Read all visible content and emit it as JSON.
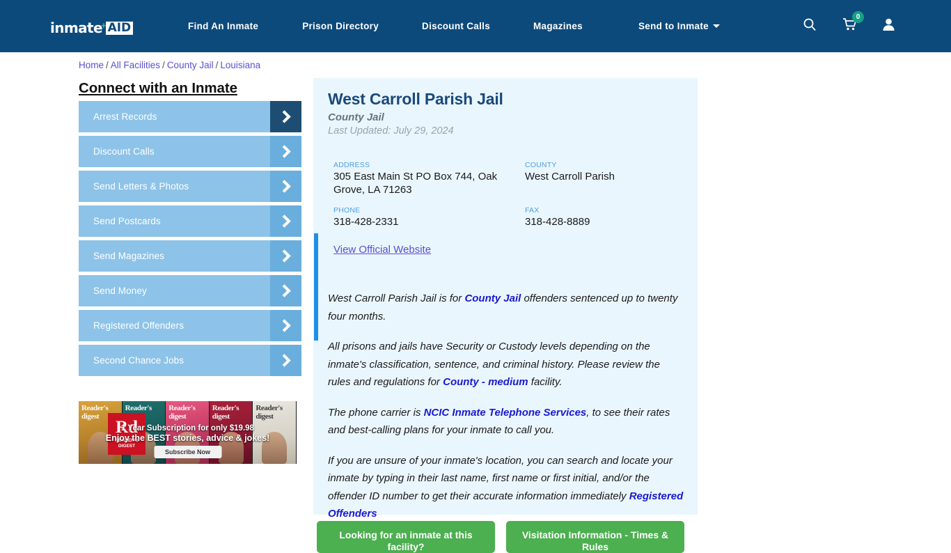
{
  "header": {
    "logo": {
      "text": "inmate",
      "plus": "+",
      "aid": "AID"
    },
    "nav": [
      {
        "label": "Find An Inmate"
      },
      {
        "label": "Prison Directory"
      },
      {
        "label": "Discount Calls"
      },
      {
        "label": "Magazines"
      },
      {
        "label": "Send to Inmate"
      }
    ],
    "icons": {
      "search": "search-icon",
      "cart": "cart-icon",
      "user": "user-icon"
    },
    "cart_count": "0",
    "bg_color": "#0d4a7c",
    "badge_color": "#16a085"
  },
  "breadcrumb": {
    "items": [
      "Home",
      "All Facilities",
      "County Jail",
      "Louisiana"
    ],
    "separator": "/"
  },
  "sidebar": {
    "title": "Connect with an Inmate",
    "items": [
      {
        "label": "Arrest Records",
        "active": true
      },
      {
        "label": "Discount Calls",
        "active": false
      },
      {
        "label": "Send Letters & Photos",
        "active": false
      },
      {
        "label": "Send Postcards",
        "active": false
      },
      {
        "label": "Send Magazines",
        "active": false
      },
      {
        "label": "Send Money",
        "active": false
      },
      {
        "label": "Registered Offenders",
        "active": false
      },
      {
        "label": "Second Chance Jobs",
        "active": false
      }
    ],
    "button_color": "#8dc3e8",
    "arrow_color": "#6aaedd",
    "arrow_active_color": "#1d4d72"
  },
  "ad": {
    "brand": "Rd",
    "brand_sub": "READER'S DIGEST",
    "line1": "1 Year Subscription for only $19.98",
    "line2": "Enjoy the BEST stories, advice & jokes!",
    "cta": "Subscribe Now",
    "covers": [
      "Reader's digest",
      "Reader's digest",
      "Reader's digest",
      "Reader's digest",
      "Reader's digest"
    ]
  },
  "facility": {
    "name": "West Carroll Parish Jail",
    "type": "County Jail",
    "last_updated": "Last Updated: July 29, 2024",
    "fields": {
      "address_label": "ADDRESS",
      "address_value": "305 East Main St PO Box 744, Oak Grove, LA 71263",
      "county_label": "COUNTY",
      "county_value": "West Carroll Parish",
      "phone_label": "PHONE",
      "phone_value": "318-428-2331",
      "fax_label": "FAX",
      "fax_value": "318-428-8889"
    },
    "website_link": "View Official Website",
    "accent_color": "#1e90e8",
    "card_bg": "#eaf6fd"
  },
  "body": {
    "p1_a": "West Carroll Parish Jail is for ",
    "p1_link": "County Jail",
    "p1_b": " offenders sentenced up to twenty four months.",
    "p2_a": "All prisons and jails have Security or Custody levels depending on the inmate's classification, sentence, and criminal history. Please review the rules and regulations for ",
    "p2_link": "County - medium",
    "p2_b": " facility.",
    "p3_a": "The phone carrier is ",
    "p3_link": "NCIC Inmate Telephone Services",
    "p3_b": ", to see their rates and best-calling plans for your inmate to call you.",
    "p4_a": "If you are unsure of your inmate's location, you can search and locate your inmate by typing in their last name, first name or first initial, and/or the offender ID number to get their accurate information immediately ",
    "p4_link": "Registered Offenders"
  },
  "actions": {
    "buttons": [
      {
        "label": "Looking for an inmate at this facility?"
      },
      {
        "label": "Visitation Information - Times & Rules"
      }
    ],
    "color": "#4caf50"
  }
}
